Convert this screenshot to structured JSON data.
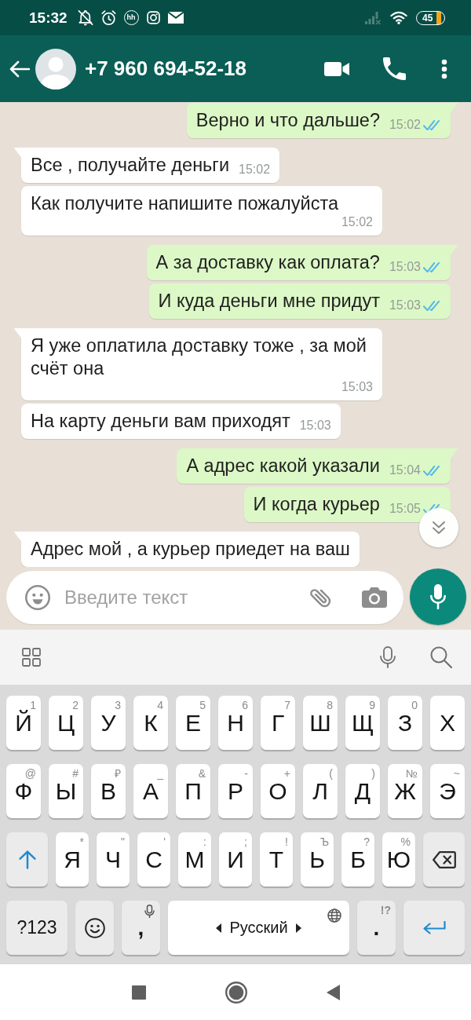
{
  "status_bar": {
    "time": "15:32",
    "app_badge": "hh",
    "battery": "45"
  },
  "header": {
    "title": "+7 960 694-52-18"
  },
  "messages": [
    {
      "kind": "outgoing",
      "text": "Верно и что дальше?",
      "time": "15:02",
      "read": true
    },
    {
      "kind": "incoming",
      "text": "Все , получайте деньги",
      "time": "15:02"
    },
    {
      "kind": "incoming",
      "text": "Как получите напишите пожалуйста",
      "time": "15:02"
    },
    {
      "kind": "outgoing",
      "text": "А за доставку как оплата?",
      "time": "15:03",
      "read": true
    },
    {
      "kind": "outgoing",
      "text": "И куда деньги мне придут",
      "time": "15:03",
      "read": true
    },
    {
      "kind": "incoming",
      "text": "Я уже оплатила доставку тоже , за мой счёт она",
      "time": "15:03"
    },
    {
      "kind": "incoming",
      "text": "На карту деньги вам приходят",
      "time": "15:03"
    },
    {
      "kind": "outgoing",
      "text": "А адрес какой указали",
      "time": "15:04",
      "read": true
    },
    {
      "kind": "outgoing",
      "text": "И когда курьер",
      "time": "15:05",
      "read": true
    },
    {
      "kind": "incoming",
      "text": "Адрес мой , а курьер приедет на ваш"
    }
  ],
  "composer": {
    "placeholder": "Введите текст"
  },
  "keyboard": {
    "rows": [
      {
        "keys": [
          {
            "kind": "letter",
            "label": "Й",
            "hint": "1"
          },
          {
            "kind": "letter",
            "label": "Ц",
            "hint": "2"
          },
          {
            "kind": "letter",
            "label": "У",
            "hint": "3"
          },
          {
            "kind": "letter",
            "label": "К",
            "hint": "4"
          },
          {
            "kind": "letter",
            "label": "Е",
            "hint": "5"
          },
          {
            "kind": "letter",
            "label": "Н",
            "hint": "6"
          },
          {
            "kind": "letter",
            "label": "Г",
            "hint": "7"
          },
          {
            "kind": "letter",
            "label": "Ш",
            "hint": "8"
          },
          {
            "kind": "letter",
            "label": "Щ",
            "hint": "9"
          },
          {
            "kind": "letter",
            "label": "З",
            "hint": "0"
          },
          {
            "kind": "letter",
            "label": "Х"
          }
        ]
      },
      {
        "keys": [
          {
            "kind": "letter",
            "label": "Ф",
            "hint": "@"
          },
          {
            "kind": "letter",
            "label": "Ы",
            "hint": "#"
          },
          {
            "kind": "letter",
            "label": "В",
            "hint": "₽"
          },
          {
            "kind": "letter",
            "label": "А",
            "hint": "_"
          },
          {
            "kind": "letter",
            "label": "П",
            "hint": "&"
          },
          {
            "kind": "letter",
            "label": "Р",
            "hint": "-"
          },
          {
            "kind": "letter",
            "label": "О",
            "hint": "+"
          },
          {
            "kind": "letter",
            "label": "Л",
            "hint": "("
          },
          {
            "kind": "letter",
            "label": "Д",
            "hint": ")"
          },
          {
            "kind": "letter",
            "label": "Ж",
            "hint": "№"
          },
          {
            "kind": "letter",
            "label": "Э",
            "hint": "~"
          }
        ]
      },
      {
        "keys": [
          {
            "kind": "shift",
            "on": true
          },
          {
            "kind": "letter",
            "label": "Я",
            "hint": "*"
          },
          {
            "kind": "letter",
            "label": "Ч",
            "hint": "\""
          },
          {
            "kind": "letter",
            "label": "С",
            "hint": "'"
          },
          {
            "kind": "letter",
            "label": "М",
            "hint": ":"
          },
          {
            "kind": "letter",
            "label": "И",
            "hint": ";"
          },
          {
            "kind": "letter",
            "label": "Т",
            "hint": "!"
          },
          {
            "kind": "letter",
            "label": "Ь",
            "hint": "Ъ"
          },
          {
            "kind": "letter",
            "label": "Б",
            "hint": "?"
          },
          {
            "kind": "letter",
            "label": "Ю",
            "hint": "%"
          },
          {
            "kind": "backspace"
          }
        ]
      },
      {
        "keys": [
          {
            "kind": "symbols",
            "label": "?123"
          },
          {
            "kind": "emoji"
          },
          {
            "kind": "comma",
            "label": ","
          },
          {
            "kind": "space",
            "label": "Русский"
          },
          {
            "kind": "period",
            "label": ".",
            "hint": "!?"
          },
          {
            "kind": "enter"
          }
        ]
      }
    ]
  }
}
